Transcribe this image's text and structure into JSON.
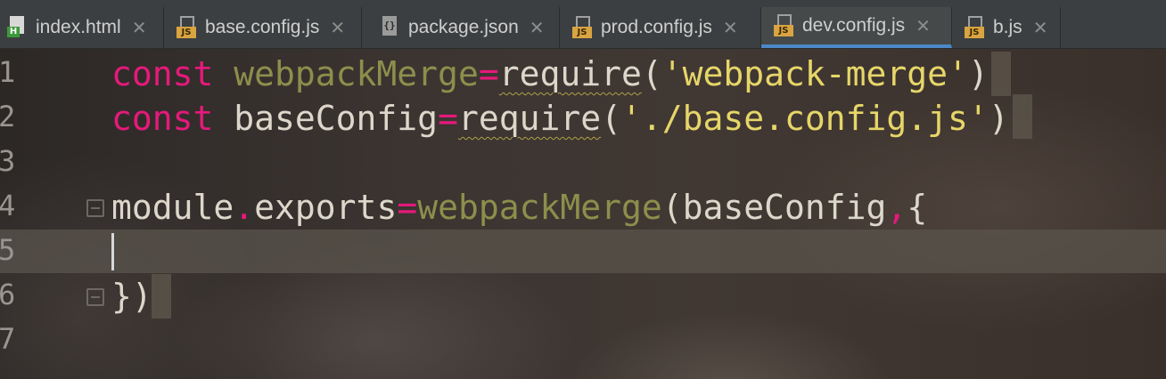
{
  "tabs": [
    {
      "label": "index.html",
      "type": "html",
      "icon": "html-file-icon",
      "badge": "H"
    },
    {
      "label": "base.config.js",
      "type": "js",
      "icon": "js-file-icon",
      "badge": "JS"
    },
    {
      "label": "package.json",
      "type": "json",
      "icon": "json-file-icon",
      "badge": "{}"
    },
    {
      "label": "prod.config.js",
      "type": "js",
      "icon": "js-file-icon",
      "badge": "JS"
    },
    {
      "label": "dev.config.js",
      "type": "js",
      "icon": "js-file-icon",
      "badge": "JS",
      "active": true
    },
    {
      "label": "b.js",
      "type": "js",
      "icon": "js-file-icon",
      "badge": "JS"
    }
  ],
  "close_glyph": "✕",
  "active_tab_color": "#4a88c7",
  "line_numbers": [
    "1",
    "2",
    "3",
    "4",
    "5",
    "6",
    "7"
  ],
  "code": {
    "line1": {
      "kw": "const",
      "name": "webpackMerge",
      "op": "=",
      "fn": "require",
      "open": "(",
      "str": "'webpack-merge'",
      "close": ")"
    },
    "line2": {
      "kw": "const",
      "name": "baseConfig",
      "op": "=",
      "fn": "require",
      "open": "(",
      "str": "'./base.config.js'",
      "close": ")"
    },
    "line4": {
      "obj": "module",
      "dot": ".",
      "prop": "exports",
      "op": "=",
      "call": "webpackMerge",
      "open": "(",
      "arg": "baseConfig",
      "comma": ",",
      "brace": "{"
    },
    "line6": {
      "text": "})"
    }
  },
  "colors": {
    "keyword": "#e6197b",
    "string": "#e6d669",
    "variable": "#8e8e4c"
  }
}
